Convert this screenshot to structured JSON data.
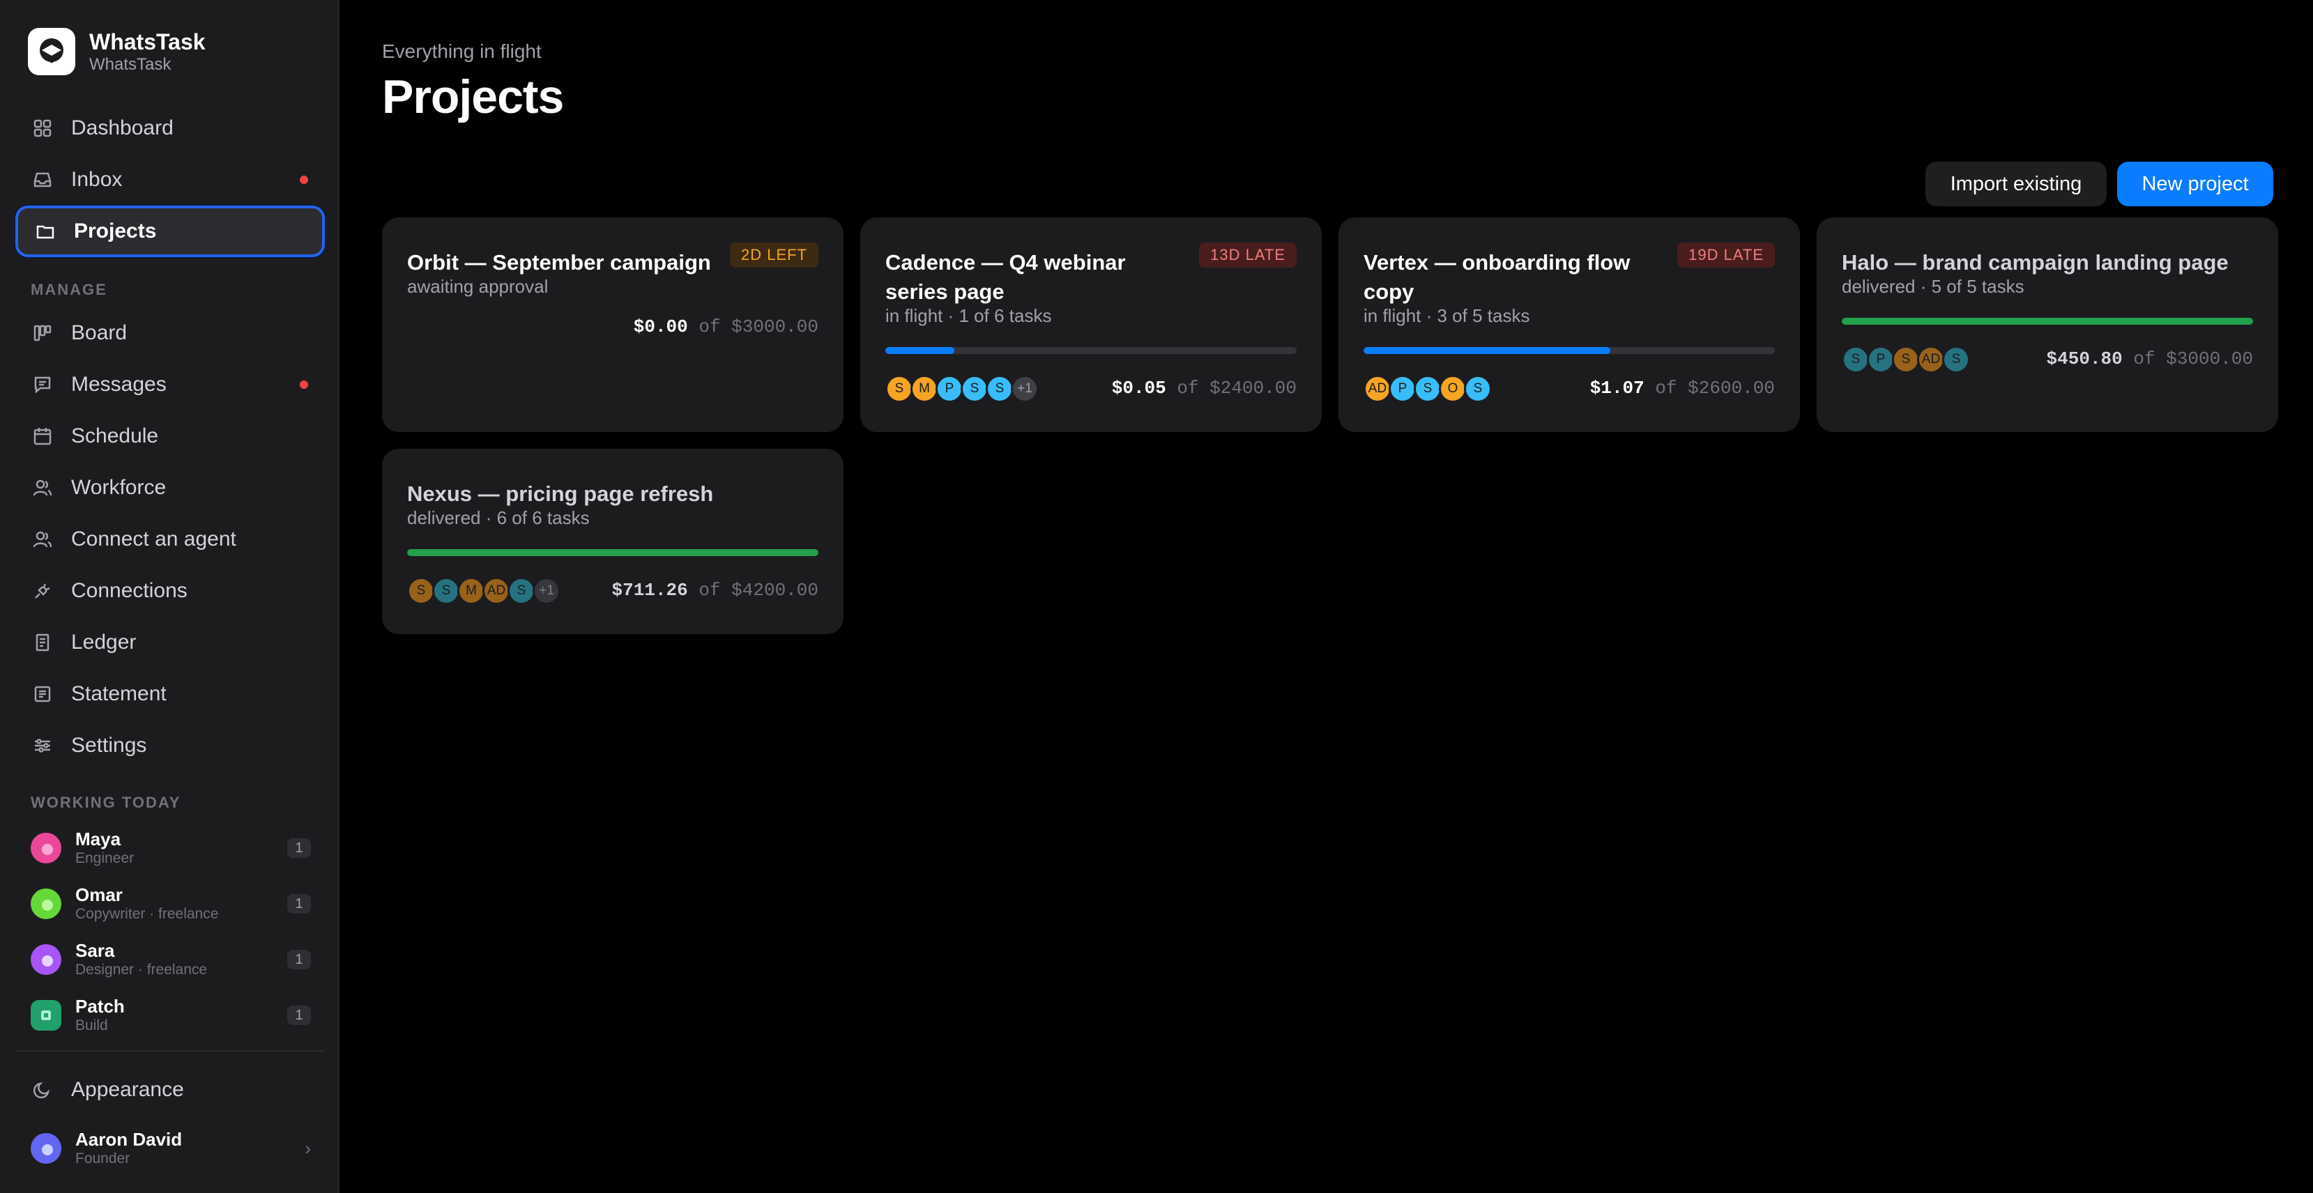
{
  "app": {
    "name": "WhatsTask",
    "workspace": "WhatsTask"
  },
  "nav": {
    "top": [
      {
        "label": "Dashboard",
        "icon": "grid-icon"
      },
      {
        "label": "Inbox",
        "icon": "inbox-icon",
        "dot": true
      },
      {
        "label": "Projects",
        "icon": "folder-icon",
        "active": true
      }
    ],
    "manage_label": "MANAGE",
    "manage": [
      {
        "label": "Board",
        "icon": "board-icon"
      },
      {
        "label": "Messages",
        "icon": "chat-icon",
        "dot": true
      },
      {
        "label": "Schedule",
        "icon": "calendar-icon"
      },
      {
        "label": "Workforce",
        "icon": "people-icon"
      },
      {
        "label": "Connect an agent",
        "icon": "people-icon"
      },
      {
        "label": "Connections",
        "icon": "plug-icon"
      },
      {
        "label": "Ledger",
        "icon": "ledger-icon"
      },
      {
        "label": "Statement",
        "icon": "statement-icon"
      },
      {
        "label": "Settings",
        "icon": "sliders-icon"
      }
    ],
    "working_label": "WORKING TODAY",
    "workers": [
      {
        "name": "Maya",
        "role": "Engineer",
        "count": "1",
        "color": "#ec4899"
      },
      {
        "name": "Omar",
        "role": "Copywriter · freelance",
        "count": "1",
        "color": "#65d83a"
      },
      {
        "name": "Sara",
        "role": "Designer · freelance",
        "count": "1",
        "color": "#a855f7"
      },
      {
        "name": "Patch",
        "role": "Build",
        "count": "1",
        "color": "#22a06b"
      }
    ],
    "appearance": "Appearance",
    "user": {
      "name": "Aaron David",
      "role": "Founder",
      "color": "#6366f1"
    }
  },
  "header": {
    "eyebrow": "Everything in flight",
    "title": "Projects",
    "import_label": "Import existing",
    "new_label": "New project"
  },
  "projects": [
    {
      "title": "Orbit — September campaign",
      "status": "awaiting approval",
      "badge": "2D LEFT",
      "badge_type": "warn",
      "progress": null,
      "spent": "$0.00",
      "budget": "of $3000.00",
      "avatars": []
    },
    {
      "title": "Cadence — Q4 webinar series page",
      "status": "in flight · 1 of 6 tasks",
      "badge": "13D LATE",
      "badge_type": "late",
      "progress": 0.167,
      "progress_color": "#0a7cff",
      "spent": "$0.05",
      "budget": "of $2400.00",
      "avatars": [
        {
          "t": "S",
          "c": "#f5a524"
        },
        {
          "t": "M",
          "c": "#f5a524"
        },
        {
          "t": "P",
          "c": "#38bdf8"
        },
        {
          "t": "S",
          "c": "#38bdf8"
        },
        {
          "t": "S",
          "c": "#38bdf8"
        },
        {
          "t": "+1",
          "c": "#3f3f46"
        }
      ]
    },
    {
      "title": "Vertex — onboarding flow copy",
      "status": "in flight · 3 of 5 tasks",
      "badge": "19D LATE",
      "badge_type": "late",
      "progress": 0.6,
      "progress_color": "#0a7cff",
      "spent": "$1.07",
      "budget": "of $2600.00",
      "avatars": [
        {
          "t": "AD",
          "c": "#f5a524"
        },
        {
          "t": "P",
          "c": "#38bdf8"
        },
        {
          "t": "S",
          "c": "#38bdf8"
        },
        {
          "t": "O",
          "c": "#f5a524"
        },
        {
          "t": "S",
          "c": "#38bdf8"
        }
      ]
    },
    {
      "title": "Halo — brand campaign landing page",
      "status": "delivered · 5 of 5 tasks",
      "badge": "",
      "progress": 1,
      "progress_color": "#22a04b",
      "spent": "$450.80",
      "budget": "of $3000.00",
      "avatars": [
        {
          "t": "S",
          "c": "#2a8fa3"
        },
        {
          "t": "P",
          "c": "#2a8fa3"
        },
        {
          "t": "S",
          "c": "#c27a1a"
        },
        {
          "t": "AD",
          "c": "#c27a1a"
        },
        {
          "t": "S",
          "c": "#2a8fa3"
        }
      ]
    },
    {
      "title": "Nexus — pricing page refresh",
      "status": "delivered · 6 of 6 tasks",
      "badge": "",
      "progress": 1,
      "progress_color": "#22a04b",
      "spent": "$711.26",
      "budget": "of $4200.00",
      "avatars": [
        {
          "t": "S",
          "c": "#c27a1a"
        },
        {
          "t": "S",
          "c": "#2a8fa3"
        },
        {
          "t": "M",
          "c": "#c27a1a"
        },
        {
          "t": "AD",
          "c": "#c27a1a"
        },
        {
          "t": "S",
          "c": "#2a8fa3"
        },
        {
          "t": "+1",
          "c": "#3f3f46"
        }
      ]
    }
  ]
}
